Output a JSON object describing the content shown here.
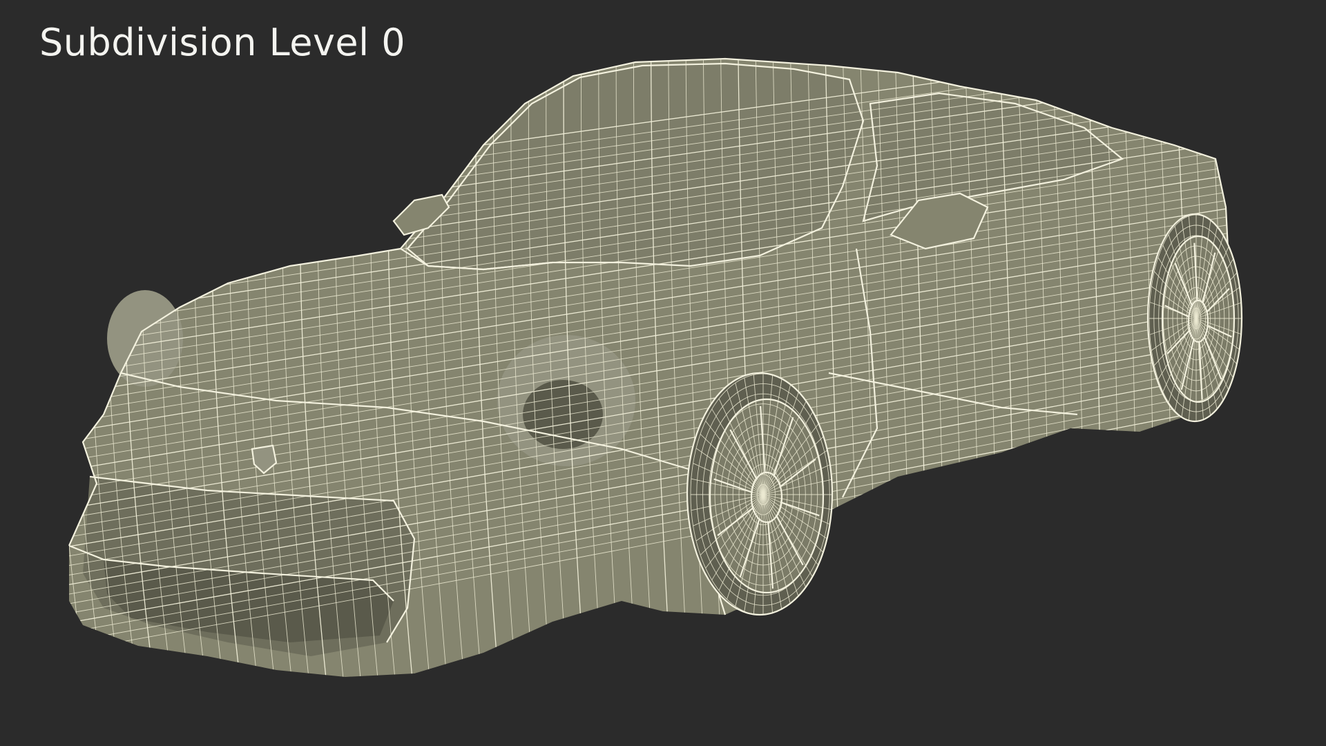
{
  "title": "Subdivision Level 0",
  "colors": {
    "background": "#2b2b2b",
    "model_fill": "#85856f",
    "wireframe": "#f1efd9",
    "title_text": "#f4f4f0"
  },
  "image": {
    "subject": "car-wireframe-render"
  }
}
